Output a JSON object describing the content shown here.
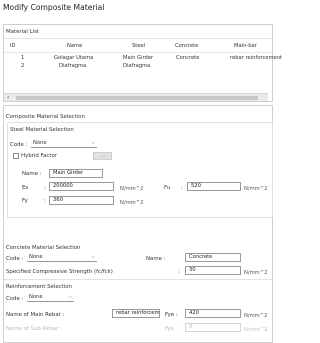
{
  "window": {
    "title": "Modify Composite Material"
  },
  "material_list": {
    "title": "Material List",
    "columns": [
      "ID",
      "Name",
      "Steel",
      "Concrete",
      "Main-bar"
    ],
    "rows": [
      [
        "1",
        "Golagar Utama",
        "Main Girder",
        "Concrete",
        "rebar reinforcement"
      ],
      [
        "2",
        "Diafragma",
        "Diafragma",
        "",
        ""
      ]
    ]
  },
  "composite_selection": {
    "title": "Composite Material Selection"
  },
  "steel": {
    "title": "Steel Material Selection",
    "code_label": "Code :",
    "code_value": "None",
    "hybrid_label": "Hybrid Factor",
    "hybrid_button": "...",
    "name_label": "Name :",
    "name_value": "Main Girder",
    "es_label": "Es",
    "es_value": "200000",
    "es_unit": "N/mm^2",
    "fu_label": "Fu",
    "fu_value": "520",
    "fu_unit": "N/mm^2",
    "fy_label": "Fy",
    "fy_value": "360",
    "fy_unit": "N/mm^2",
    "colon": ":"
  },
  "concrete": {
    "title": "Concrete Material Selection",
    "code_label": "Code :",
    "code_value": "None",
    "name_label": "Name :",
    "name_value": "Concrete",
    "strength_label": "Specified Compressive Strength (fc/fck)",
    "strength_value": "30",
    "strength_unit": "N/mm^2"
  },
  "reinforcement": {
    "title": "Reinforcement Selection",
    "code_label": "Code :",
    "code_value": "None",
    "main_label": "Name of Main Rebar :",
    "main_value": "rebar reinforcemen",
    "fye_label": "Fye :",
    "fye_value": "420",
    "fye_unit": "N/mm^2",
    "sub_label": "Name of Sub Rebar :",
    "fys_label": "Fys :",
    "fys_value": "0",
    "fys_unit": "N/mm^2"
  }
}
